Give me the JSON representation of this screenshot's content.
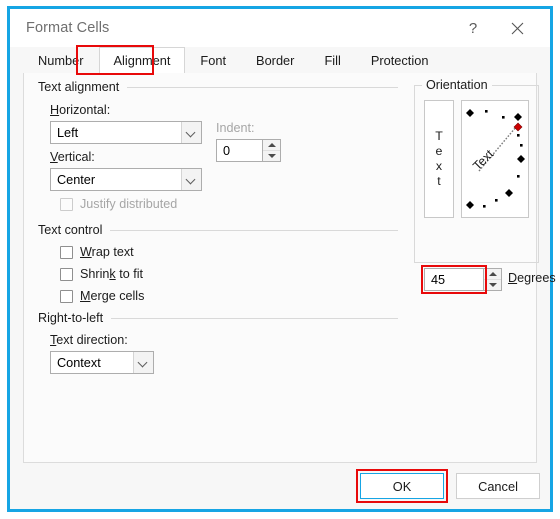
{
  "window": {
    "title": "Format Cells",
    "help_icon": "?",
    "close_icon": "close-icon",
    "border_color": "#16A5E4"
  },
  "tabs": [
    {
      "label": "Number",
      "selected": false
    },
    {
      "label": "Alignment",
      "selected": true
    },
    {
      "label": "Font",
      "selected": false
    },
    {
      "label": "Border",
      "selected": false
    },
    {
      "label": "Fill",
      "selected": false
    },
    {
      "label": "Protection",
      "selected": false
    }
  ],
  "highlight_color": "#e8090a",
  "text_alignment": {
    "group_label": "Text alignment",
    "horizontal": {
      "label": "Horizontal:",
      "value": "Left"
    },
    "vertical": {
      "label": "Vertical:",
      "value": "Center"
    },
    "indent": {
      "label": "Indent:",
      "value": "0",
      "disabled_label": true
    },
    "justify_distributed": {
      "label": "Justify distributed",
      "checked": false,
      "disabled": true
    }
  },
  "text_control": {
    "group_label": "Text control",
    "items": [
      {
        "label": "Wrap text",
        "checked": false
      },
      {
        "label": "Shrink to fit",
        "checked": false
      },
      {
        "label": "Merge cells",
        "checked": false
      }
    ]
  },
  "right_to_left": {
    "group_label": "Right-to-left",
    "text_direction": {
      "label": "Text direction:",
      "value": "Context"
    }
  },
  "orientation": {
    "group_label": "Orientation",
    "vertical_text_label": "Text",
    "vertical_letters": [
      "T",
      "e",
      "x",
      "t"
    ],
    "dial_text": "Text",
    "degrees": {
      "value": "45",
      "label": "Degrees"
    },
    "handle_color": "#cc0000",
    "marker_color": "#000000"
  },
  "footer": {
    "ok": "OK",
    "cancel": "Cancel"
  }
}
